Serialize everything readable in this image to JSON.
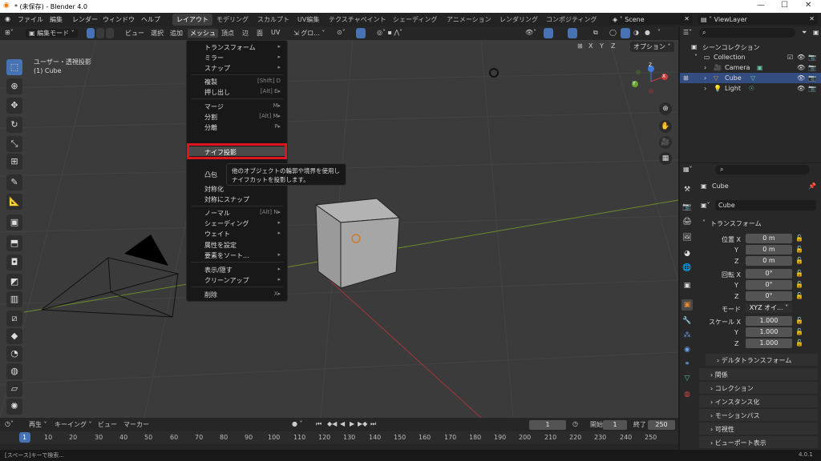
{
  "window": {
    "title": "* (未保存) - Blender 4.0"
  },
  "menubar": {
    "items": [
      "ファイル",
      "編集",
      "レンダー",
      "ウィンドウ",
      "ヘルプ"
    ],
    "tabs": [
      "レイアウト",
      "モデリング",
      "スカルプト",
      "UV編集",
      "テクスチャペイント",
      "シェーディング",
      "アニメーション",
      "レンダリング",
      "コンポジティング"
    ],
    "scene": "Scene",
    "view_layer": "ViewLayer"
  },
  "viewport_header": {
    "mode": "編集モード",
    "menus": [
      "ビュー",
      "選択",
      "追加",
      "メッシュ",
      "頂点",
      "辺",
      "面",
      "UV"
    ],
    "orientation": "グロ...",
    "options": "オプション",
    "axes": [
      "X",
      "Y",
      "Z"
    ]
  },
  "viewport": {
    "view_name": "ユーザー・透視投影",
    "object_name": "(1) Cube",
    "gizmo_axes": [
      "X",
      "Y",
      "Z"
    ]
  },
  "mesh_menu": {
    "items": [
      {
        "label": "トランスフォーム",
        "shortcut": "▸"
      },
      {
        "label": "ミラー",
        "shortcut": "▸"
      },
      {
        "label": "スナップ",
        "shortcut": "▸"
      },
      {
        "label": "複製",
        "shortcut": "[Shift] D"
      },
      {
        "label": "押し出し",
        "shortcut": "[Alt] E▸"
      },
      {
        "label": "マージ",
        "shortcut": "M▸"
      },
      {
        "label": "分割",
        "shortcut": "[Alt] M▸"
      },
      {
        "label": "分離",
        "shortcut": "P▸"
      },
      {
        "label": "ナイフ投影",
        "shortcut": ""
      },
      {
        "label": "凸包",
        "shortcut": ""
      },
      {
        "label": "対称化",
        "shortcut": ""
      },
      {
        "label": "対称にスナップ",
        "shortcut": ""
      },
      {
        "label": "ノーマル",
        "shortcut": "[Alt] N▸"
      },
      {
        "label": "シェーディング",
        "shortcut": "▸"
      },
      {
        "label": "ウェイト",
        "shortcut": "▸"
      },
      {
        "label": "属性を設定",
        "shortcut": ""
      },
      {
        "label": "要素をソート...",
        "shortcut": "▸"
      },
      {
        "label": "表示/隠す",
        "shortcut": "▸"
      },
      {
        "label": "クリーンアップ",
        "shortcut": "▸"
      },
      {
        "label": "削除",
        "shortcut": "X▸"
      }
    ],
    "highlight_color": "#e0141c"
  },
  "tooltip": {
    "line1": "他のオブジェクトの輪郭や境界を使用し",
    "line2": "ナイフカットを投影します。"
  },
  "outliner": {
    "header": "シーンコレクション",
    "items": [
      "Collection",
      "Camera",
      "Cube",
      "Light"
    ]
  },
  "properties": {
    "object_name": "Cube",
    "object_field": "Cube",
    "transform_label": "トランスフォーム",
    "location": {
      "label_x": "位置 X",
      "x": "0 m",
      "y": "0 m",
      "z": "0 m"
    },
    "rotation": {
      "label_x": "回転 X",
      "x": "0°",
      "y": "0°",
      "z": "0°"
    },
    "mode": {
      "label": "モード",
      "value": "XYZ オイ..."
    },
    "scale": {
      "label_x": "スケール X",
      "x": "1.000",
      "y": "1.000",
      "z": "1.000"
    },
    "axis_y": "Y",
    "axis_z": "Z",
    "sections": [
      "デルタトランスフォーム",
      "関係",
      "コレクション",
      "インスタンス化",
      "モーションパス",
      "可視性",
      "ビューポート表示"
    ]
  },
  "timeline": {
    "menus": [
      "再生",
      "キーイング",
      "ビュー",
      "マーカー"
    ],
    "current_frame": "1",
    "start_label": "開始",
    "start": "1",
    "end_label": "終了",
    "end": "250",
    "ticks": [
      "1",
      "10",
      "20",
      "30",
      "40",
      "50",
      "60",
      "70",
      "80",
      "90",
      "100",
      "110",
      "120",
      "130",
      "140",
      "150",
      "160",
      "170",
      "180",
      "190",
      "200",
      "210",
      "220",
      "230",
      "240",
      "250"
    ]
  },
  "status": {
    "hint": "[スペース]キーで検索...",
    "version": "4.0.1"
  }
}
